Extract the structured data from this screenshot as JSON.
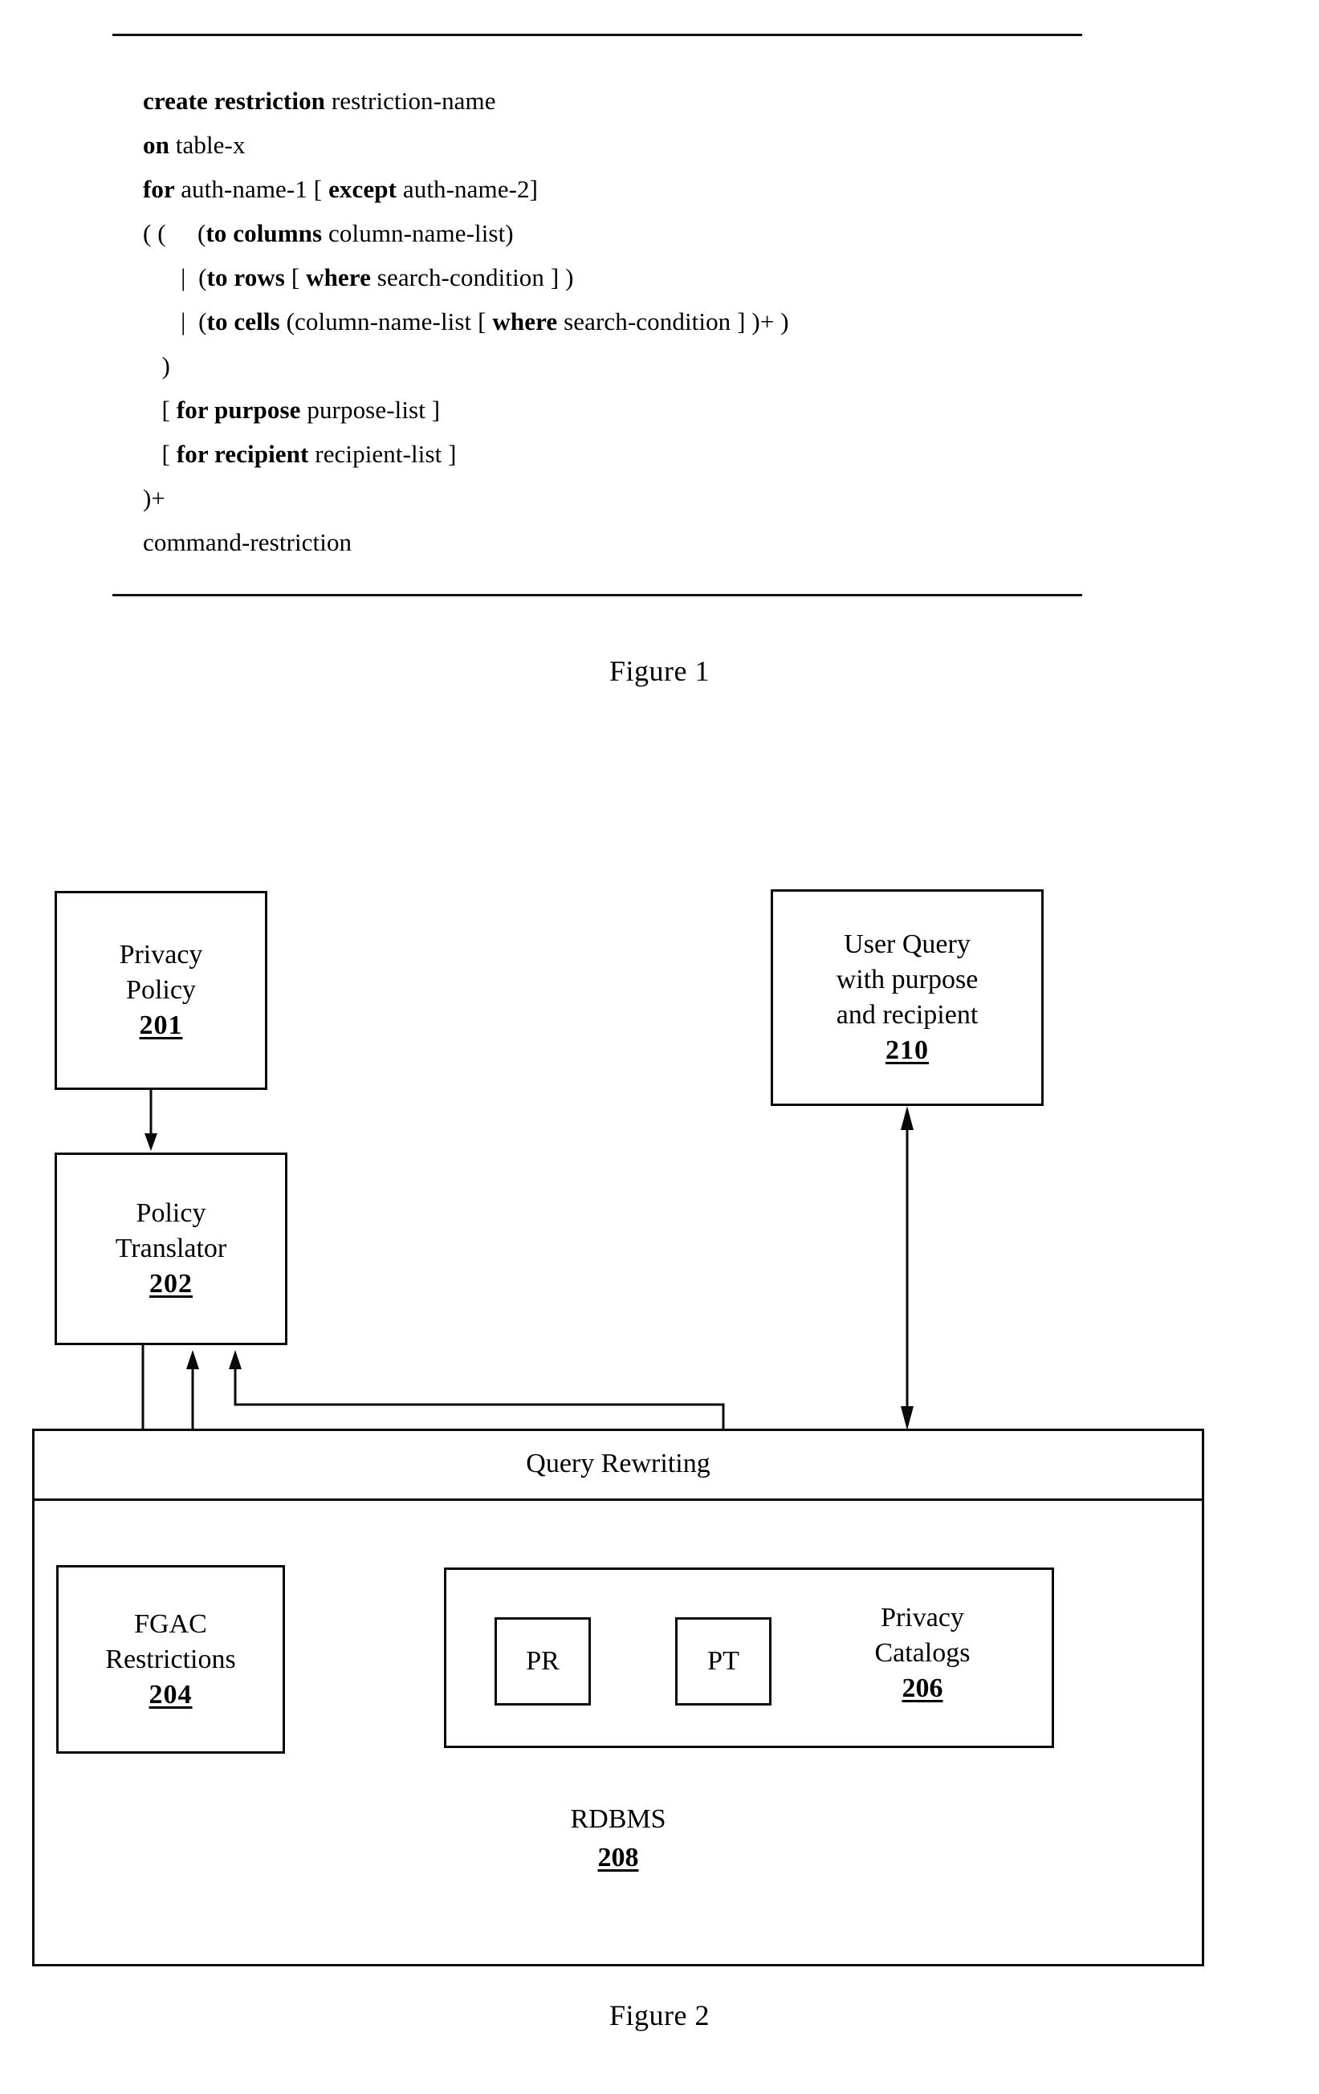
{
  "document": {
    "type": "patent-figure-sheet"
  },
  "figure1": {
    "caption": "Figure 1",
    "syntax_lines": [
      {
        "indent": 0,
        "parts": [
          {
            "t": "create restriction ",
            "b": true
          },
          {
            "t": "restriction-name",
            "b": false
          }
        ]
      },
      {
        "indent": 0,
        "parts": [
          {
            "t": "on ",
            "b": true
          },
          {
            "t": "table-x",
            "b": false
          }
        ]
      },
      {
        "indent": 0,
        "parts": [
          {
            "t": "for ",
            "b": true
          },
          {
            "t": "auth-name-1 [ ",
            "b": false
          },
          {
            "t": "except ",
            "b": true
          },
          {
            "t": "auth-name-2]",
            "b": false
          }
        ]
      },
      {
        "indent": 0,
        "parts": [
          {
            "t": "( (     (",
            "b": false
          },
          {
            "t": "to columns ",
            "b": true
          },
          {
            "t": "column-name-list)",
            "b": false
          }
        ]
      },
      {
        "indent": 0,
        "parts": [
          {
            "t": "      |  (",
            "b": false
          },
          {
            "t": "to rows ",
            "b": true
          },
          {
            "t": "[ ",
            "b": false
          },
          {
            "t": "where ",
            "b": true
          },
          {
            "t": "search-condition ] )",
            "b": false
          }
        ]
      },
      {
        "indent": 0,
        "parts": [
          {
            "t": "      |  (",
            "b": false
          },
          {
            "t": "to cells ",
            "b": true
          },
          {
            "t": "(column-name-list [ ",
            "b": false
          },
          {
            "t": "where ",
            "b": true
          },
          {
            "t": "search-condition ] )+ )",
            "b": false
          }
        ]
      },
      {
        "indent": 0,
        "parts": [
          {
            "t": "   )",
            "b": false
          }
        ]
      },
      {
        "indent": 0,
        "parts": [
          {
            "t": "   [ ",
            "b": false
          },
          {
            "t": "for purpose ",
            "b": true
          },
          {
            "t": "purpose-list ]",
            "b": false
          }
        ]
      },
      {
        "indent": 0,
        "parts": [
          {
            "t": "   [ ",
            "b": false
          },
          {
            "t": "for recipient ",
            "b": true
          },
          {
            "t": "recipient-list ]",
            "b": false
          }
        ]
      },
      {
        "indent": 0,
        "parts": [
          {
            "t": ")+",
            "b": false
          }
        ]
      },
      {
        "indent": 0,
        "parts": [
          {
            "t": "command-restriction",
            "b": false
          }
        ]
      }
    ]
  },
  "figure2": {
    "caption": "Figure 2",
    "nodes": {
      "privacy_policy": {
        "label": "Privacy\nPolicy",
        "number": "201"
      },
      "user_query": {
        "label": "User Query\nwith purpose\nand recipient",
        "number": "210"
      },
      "policy_translator": {
        "label": "Policy\nTranslator",
        "number": "202"
      },
      "fgac_restrictions": {
        "label": "FGAC\nRestrictions",
        "number": "204"
      },
      "privacy_catalogs": {
        "label": "Privacy\nCatalogs",
        "number": "206"
      },
      "rdbms": {
        "label": "RDBMS",
        "number": "208"
      },
      "query_rewriting": {
        "label": "Query Rewriting",
        "number": ""
      },
      "pr": {
        "label": "PR",
        "number": ""
      },
      "pt": {
        "label": "PT",
        "number": ""
      }
    },
    "edges": [
      {
        "from": "privacy_policy",
        "to": "policy_translator",
        "arrow": "single-down"
      },
      {
        "from": "policy_translator",
        "to": "fgac_restrictions",
        "arrow": "single-down"
      },
      {
        "from": "pr",
        "to": "policy_translator",
        "arrow": "single-up"
      },
      {
        "from": "pt",
        "to": "policy_translator",
        "arrow": "single-up"
      },
      {
        "from": "user_query",
        "to": "query_rewriting",
        "arrow": "double"
      }
    ]
  },
  "colors": {
    "ink": "#0a0a0a",
    "paper": "#ffffff"
  }
}
